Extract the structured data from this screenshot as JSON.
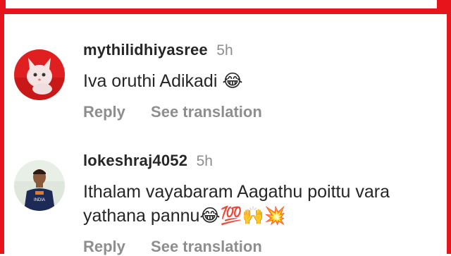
{
  "comments": [
    {
      "username": "mythilidhiyasree",
      "time": "5h",
      "text_lines": [
        "Iva oruthi Adikadi 😂"
      ],
      "reply_label": "Reply",
      "translate_label": "See translation",
      "avatar": "cat-avatar"
    },
    {
      "username": "lokeshraj4052",
      "time": "5h",
      "text_lines": [
        "Ithalam vayabaram Aagathu poittu vara",
        "yathana pannu😂💯🙌💥"
      ],
      "reply_label": "Reply",
      "translate_label": "See translation",
      "avatar": "cricketer-avatar"
    }
  ],
  "colors": {
    "frame": "#e8141c",
    "username": "#262626",
    "muted": "#8e8e8e"
  }
}
